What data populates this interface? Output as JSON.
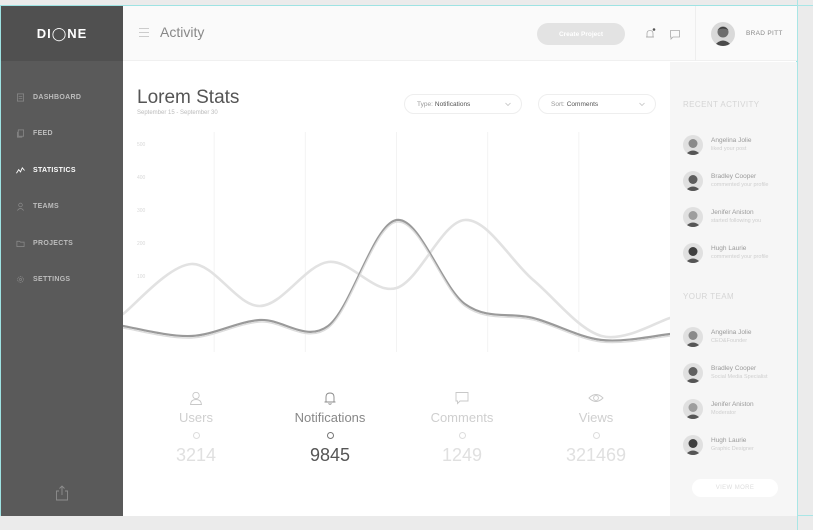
{
  "app": {
    "logo": "DI◯NE",
    "title": "Activity"
  },
  "header": {
    "create_label": "Create Project",
    "user_name": "BRAD PITT"
  },
  "sidebar": {
    "items": [
      {
        "label": "DASHBOARD",
        "icon": "dashboard-icon",
        "active": false
      },
      {
        "label": "FEED",
        "icon": "feed-icon",
        "active": false
      },
      {
        "label": "STATISTICS",
        "icon": "statistics-icon",
        "active": true
      },
      {
        "label": "TEAMS",
        "icon": "teams-icon",
        "active": false
      },
      {
        "label": "PROJECTS",
        "icon": "projects-icon",
        "active": false
      },
      {
        "label": "SETTINGS",
        "icon": "settings-icon",
        "active": false
      }
    ],
    "share_icon": "share-icon"
  },
  "main": {
    "title": "Lorem Stats",
    "subtitle": "September 15 - September 30",
    "type_filter": {
      "prefix": "Type:",
      "value": "Notifications"
    },
    "sort_filter": {
      "prefix": "Sort:",
      "value": "Comments"
    },
    "stats": [
      {
        "label": "Users",
        "value": "3214",
        "icon": "user-icon",
        "active": false
      },
      {
        "label": "Notifications",
        "value": "9845",
        "icon": "bell-icon",
        "active": true
      },
      {
        "label": "Comments",
        "value": "1249",
        "icon": "comment-icon",
        "active": false
      },
      {
        "label": "Views",
        "value": "321469",
        "icon": "eye-icon",
        "active": false
      }
    ]
  },
  "chart_data": {
    "type": "line",
    "title": "",
    "ylim": [
      0,
      500
    ],
    "y_ticks": [
      "500",
      "400",
      "300",
      "200",
      "100"
    ],
    "grid": true,
    "series": [
      {
        "values": [
          40,
          15,
          55,
          40,
          305,
          95,
          60,
          5,
          20
        ]
      },
      {
        "values": [
          70,
          195,
          90,
          200,
          135,
          305,
          155,
          15,
          60
        ]
      }
    ],
    "colors": [
      "#9a9a9a",
      "#e2e2e2"
    ]
  },
  "right_panel": {
    "recent_heading": "RECENT ACTIVITY",
    "recent": [
      {
        "name": "Angelina Jolie",
        "sub": "liked your post"
      },
      {
        "name": "Bradley Cooper",
        "sub": "commented your profile"
      },
      {
        "name": "Jenifer Aniston",
        "sub": "started following you"
      },
      {
        "name": "Hugh Laurie",
        "sub": "commented your profile"
      }
    ],
    "team_heading": "YOUR TEAM",
    "team": [
      {
        "name": "Angelina Jolie",
        "sub": "CEO&Founder"
      },
      {
        "name": "Bradley Cooper",
        "sub": "Social Media Specialist"
      },
      {
        "name": "Jenifer Aniston",
        "sub": "Moderator"
      },
      {
        "name": "Hugh Laurie",
        "sub": "Graphic Designer"
      }
    ],
    "view_more": "VIEW MORE"
  }
}
